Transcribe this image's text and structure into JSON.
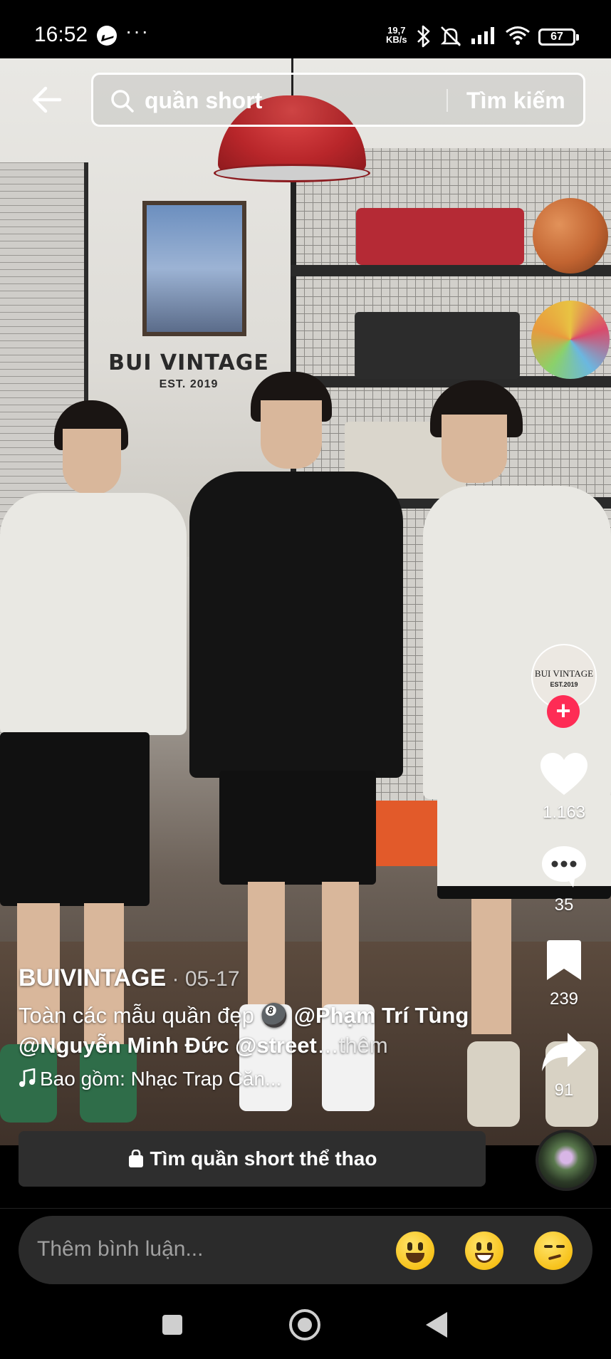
{
  "status_bar": {
    "time": "16:52",
    "net_speed_value": "19,7",
    "net_speed_unit": "KB/s",
    "battery": "67",
    "icons": [
      "messenger-icon",
      "more-icon",
      "bluetooth-icon",
      "mute-icon",
      "signal-icon",
      "wifi-icon",
      "battery-icon"
    ]
  },
  "search": {
    "query": "quần short",
    "submit_label": "Tìm kiếm"
  },
  "video_scene": {
    "sign_brand": "BUI VINTAGE",
    "sign_est": "EST. 2019"
  },
  "creator": {
    "avatar_line1": "BUI VINTAGE",
    "avatar_line2": "EST.2019",
    "follow_label": "+"
  },
  "actions": {
    "likes": "1.163",
    "comments": "35",
    "saves": "239",
    "shares": "91"
  },
  "caption": {
    "author": "BUIVINTAGE",
    "date": " · 05-17",
    "text_start": "Toàn các mẫu quần đẹp ",
    "emoji": "🎱",
    "mention1": "@Phạm Trí Tùng",
    "mention2": "@Nguyễn Minh Đức",
    "mention3": "@street",
    "ellipsis": "…",
    "more": "thêm",
    "music": "Bao gồm: Nhạc Trap Căn..."
  },
  "search_banner": {
    "label": "Tìm quần short thể thao"
  },
  "comment_bar": {
    "placeholder": "Thêm bình luận..."
  },
  "colors": {
    "accent": "#fe2c55",
    "banner_bg": "#2e2e2e",
    "input_bg": "#2b2b2b"
  }
}
